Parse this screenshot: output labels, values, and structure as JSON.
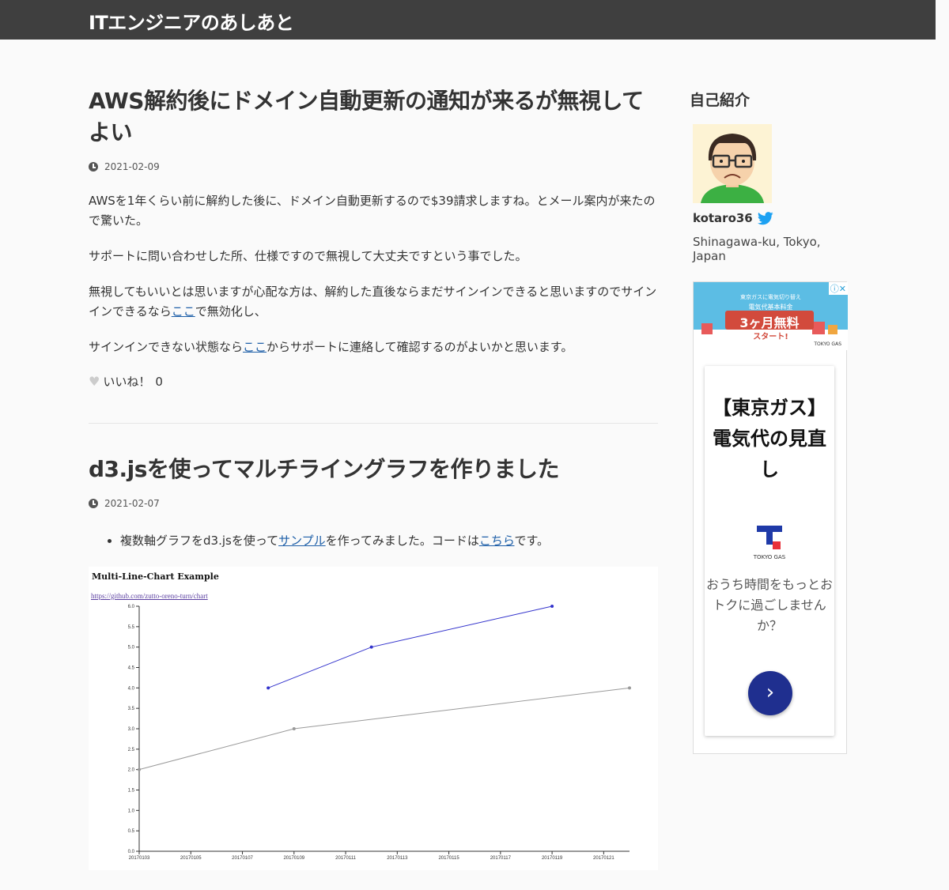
{
  "site": {
    "title": "ITエンジニアのあしあと"
  },
  "post1": {
    "title": "AWS解約後にドメイン自動更新の通知が来るが無視してよい",
    "date": "2021-02-09",
    "p1": "AWSを1年くらい前に解約した後に、ドメイン自動更新するので$39請求しますね。とメール案内が来たので驚いた。",
    "p2": "サポートに問い合わせした所、仕様ですので無視して大丈夫ですという事でした。",
    "p3_a": "無視してもいいとは思いますが心配な方は、解約した直後ならまだサインインできると思いますのでサインインできるなら",
    "p3_link": "ここ",
    "p3_b": "で無効化し、",
    "p4_a": "サインインできない状態なら",
    "p4_link": "ここ",
    "p4_b": "からサポートに連絡して確認するのがよいかと思います。",
    "like_label": "いいね！",
    "like_count": "0"
  },
  "post2": {
    "title": "d3.jsを使ってマルチライングラフを作りました",
    "date": "2021-02-07",
    "bullet_a": "複数軸グラフをd3.jsを使って",
    "bullet_link1": "サンプル",
    "bullet_b": "を作ってみました。コードは",
    "bullet_link2": "こちら",
    "bullet_c": "です。"
  },
  "chart_data": {
    "type": "line",
    "title": "Multi-Line-Chart Example",
    "link_text": "https://github.com/zutto-oreno-turn/chart",
    "x_tick_labels": [
      "20170103",
      "20170105",
      "20170107",
      "20170109",
      "20170111",
      "20170113",
      "20170115",
      "20170117",
      "20170119",
      "20170121"
    ],
    "y_tick_labels": [
      "0.0",
      "0.5",
      "1.0",
      "1.5",
      "2.0",
      "2.5",
      "3.0",
      "3.5",
      "4.0",
      "4.5",
      "5.0",
      "5.5",
      "6.0"
    ],
    "ylim": [
      0,
      6
    ],
    "x_range": [
      "20170103",
      "20170122"
    ],
    "series": [
      {
        "color": "#3333cc",
        "points": [
          {
            "x": "20170108",
            "y": 4.0
          },
          {
            "x": "20170112",
            "y": 5.0
          },
          {
            "x": "20170119",
            "y": 6.0
          }
        ]
      },
      {
        "color": "#999999",
        "points": [
          {
            "x": "20170103",
            "y": 2.0
          },
          {
            "x": "20170109",
            "y": 3.0
          },
          {
            "x": "20170122",
            "y": 4.0
          }
        ]
      }
    ]
  },
  "sidebar": {
    "heading": "自己紹介",
    "author": "kotaro36",
    "location": "Shinagawa-ku, Tokyo, Japan"
  },
  "ad": {
    "banner_text": "3ヶ月無料",
    "banner_sub": "スタート!",
    "banner_top": "東京ガスに電気切り替え",
    "banner_mid": "電気代基本料金",
    "brand_small": "TOKYO GAS",
    "close_icons": "ⓘ✕",
    "headline": "【東京ガス】電気代の見直し",
    "brand": "TOKYO GAS",
    "body": "おうち時間をもっとおトクに過ごしませんか？",
    "button_icon": "chevron-right-icon"
  },
  "colors": {
    "header_bg": "#3f3f3f",
    "link": "#1e5fa8",
    "line1": "#3333cc",
    "line2": "#999999",
    "ad_button": "#1f2f8f"
  }
}
